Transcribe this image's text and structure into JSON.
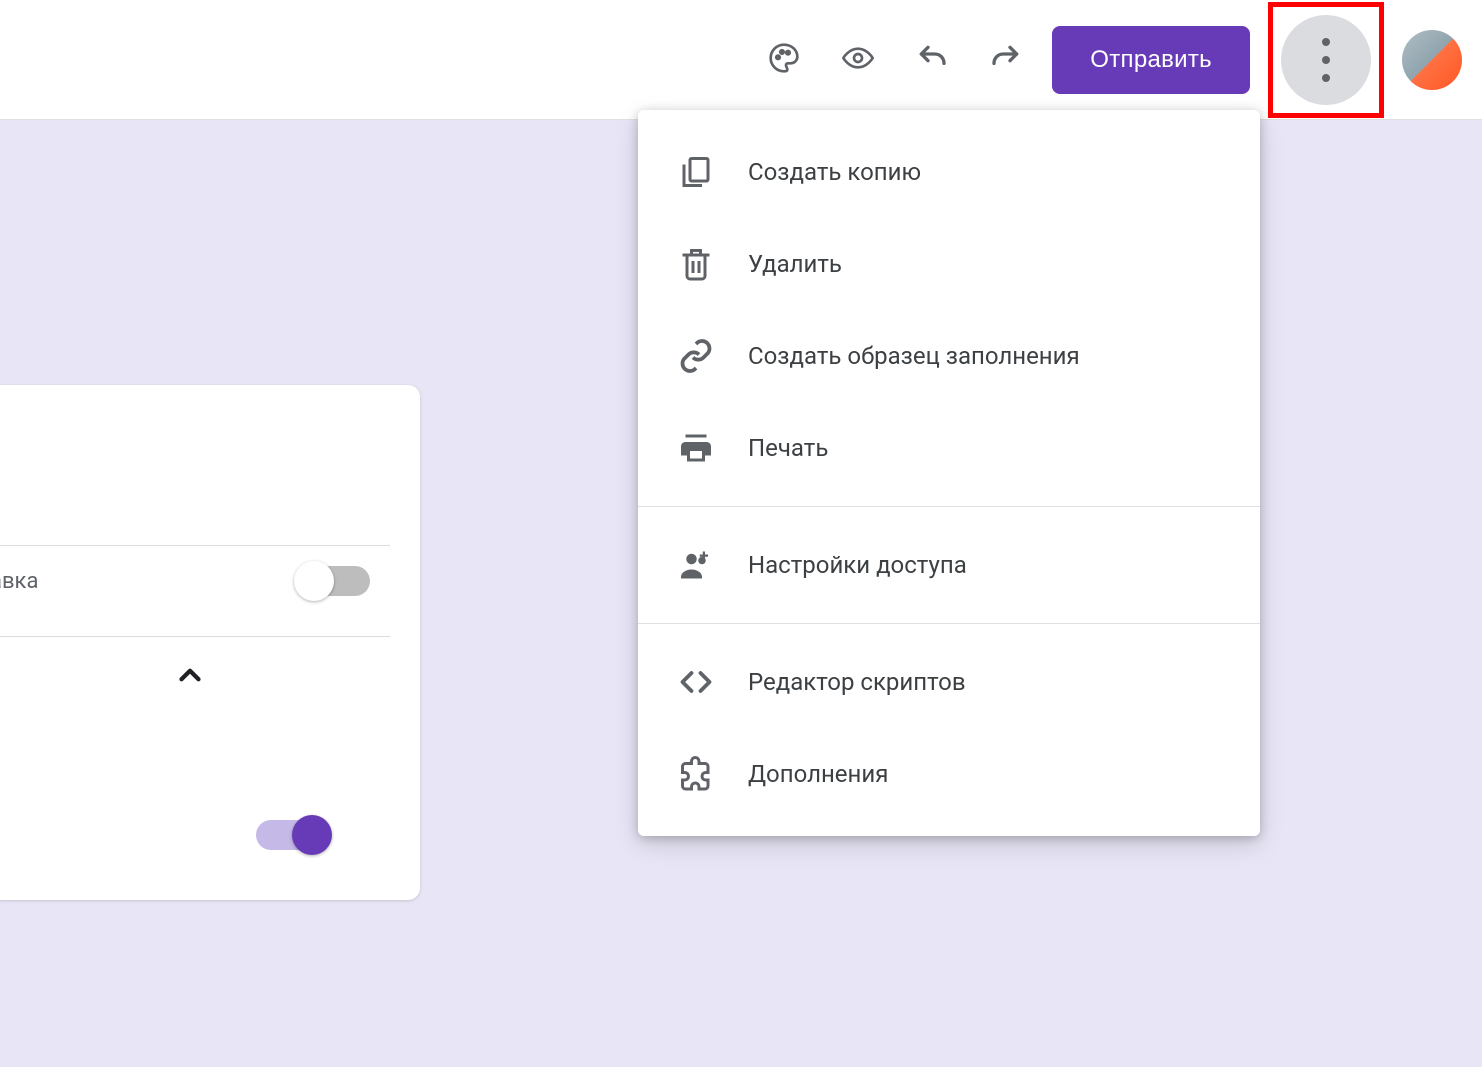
{
  "toolbar": {
    "send_label": "Отправить",
    "menu_items": [
      {
        "label": "Создать копию",
        "icon": "copy-icon"
      },
      {
        "label": "Удалить",
        "icon": "trash-icon"
      },
      {
        "label": "Создать образец заполнения",
        "icon": "link-icon"
      },
      {
        "label": "Печать",
        "icon": "print-icon"
      }
    ],
    "menu_items_group2": [
      {
        "label": "Настройки доступа",
        "icon": "person-add-icon"
      }
    ],
    "menu_items_group3": [
      {
        "label": "Редактор скриптов",
        "icon": "code-icon"
      },
      {
        "label": "Дополнения",
        "icon": "puzzle-icon"
      }
    ]
  },
  "form": {
    "row_text_fragment": "авка",
    "switch1_state": "off",
    "switch2_state": "on"
  },
  "colors": {
    "primary": "#673ab7",
    "highlight": "#ff0000",
    "canvas_bg": "#e8e5f6"
  }
}
